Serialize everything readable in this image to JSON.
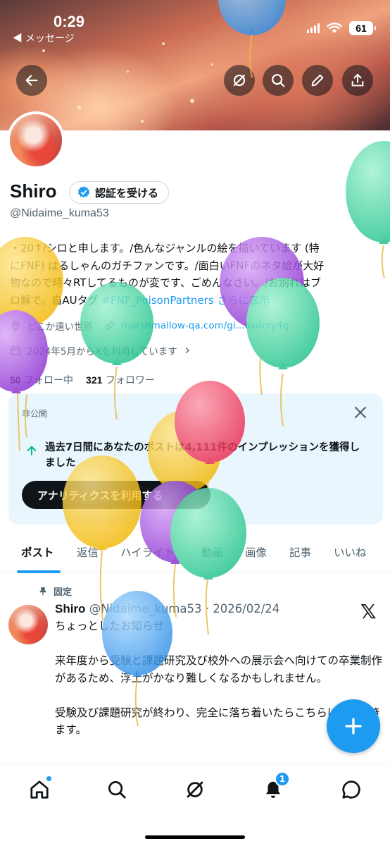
{
  "status_bar": {
    "time": "0:29",
    "back_app": "◀ メッセージ",
    "battery": "61"
  },
  "profile": {
    "display_name": "Shiro",
    "verify_button": "認証を受ける",
    "handle": "@Nidaime_kuma53",
    "bio_line1": "・20↑/シロと申します。/色んなジャンルの絵を描いています (特",
    "bio_line2": "にFNF) はるしゃんのガチファンです。/面白いFNFのネタ絵が大好",
    "bio_line3": "物なので時々RTしてるものが変です、ごめんなさい。/お別れはブ",
    "bio_line4_prefix": "ロ解で。自AUタグ ",
    "bio_hashtag": "#FNF_PoisonPartners",
    "bio_more": "さらに表示",
    "location": "どこか遠い世界",
    "website": "marshmallow-qa.com/gi...oxdcry4q...",
    "joined": "2024年5月からXを利用しています",
    "following_count": "50",
    "following_label": "フォロー中",
    "followers_count": "321",
    "followers_label": "フォロワー"
  },
  "analytics_card": {
    "private_label": "非公開",
    "message": "過去7日間にあなたのポストは4,111件のインプレッションを獲得しました",
    "cta": "アナリティクスを利用する"
  },
  "tabs": [
    "ポスト",
    "返信",
    "ハイライト",
    "動画",
    "画像",
    "記事",
    "いいね"
  ],
  "post": {
    "pinned_label": "固定",
    "author": "Shiro",
    "handle_date": "@Nidaime_kuma53 · 2026/02/24",
    "title": "ちょっとしたお知らせ",
    "paragraph1": "来年度から受験と課題研究及び校外への展示会へ向けての卒業制作があるため、浮上がかなり難しくなるかもしれません。",
    "paragraph2": "受験及び課題研究が終わり、完全に落ち着いたらこちらに戻ってきます。"
  },
  "bottom_nav": {
    "notification_count": "1"
  },
  "colors": {
    "accent": "#1d9bf0",
    "text": "#0f1419",
    "muted": "#536471",
    "card_bg": "#e9f6fd"
  },
  "icons": [
    "back-arrow-icon",
    "grok-icon",
    "search-icon",
    "edit-icon",
    "share-icon",
    "verified-icon",
    "location-icon",
    "link-icon",
    "calendar-icon",
    "close-icon",
    "arrow-up-icon",
    "pin-icon",
    "x-logo-icon",
    "plus-icon",
    "home-icon",
    "search-icon",
    "grok-icon",
    "bell-icon",
    "chat-icon"
  ]
}
